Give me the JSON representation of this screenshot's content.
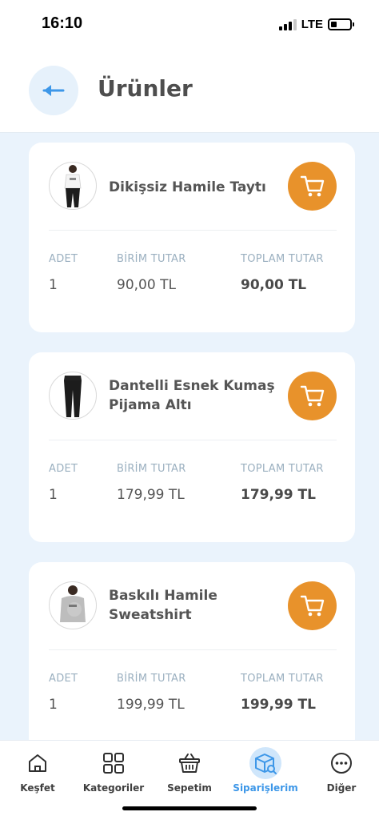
{
  "status_bar": {
    "time": "16:10",
    "network": "LTE"
  },
  "header": {
    "title": "Ürünler",
    "back_icon": "arrow-left-icon"
  },
  "columns": {
    "qty": "ADET",
    "unit": "BİRİM TUTAR",
    "total": "TOPLAM TUTAR"
  },
  "products": [
    {
      "name": "Dikişsiz Hamile Taytı",
      "qty": "1",
      "unit_price": "90,00 TL",
      "total_price": "90,00 TL"
    },
    {
      "name": "Dantelli Esnek Kumaş Pijama Altı",
      "qty": "1",
      "unit_price": "179,99 TL",
      "total_price": "179,99 TL"
    },
    {
      "name": "Baskılı Hamile Sweatshirt",
      "qty": "1",
      "unit_price": "199,99 TL",
      "total_price": "199,99 TL"
    }
  ],
  "nav": {
    "items": [
      {
        "label": "Keşfet",
        "icon": "home-icon"
      },
      {
        "label": "Kategoriler",
        "icon": "grid-icon"
      },
      {
        "label": "Sepetim",
        "icon": "basket-icon"
      },
      {
        "label": "Siparişlerim",
        "icon": "box-search-icon"
      },
      {
        "label": "Diğer",
        "icon": "more-icon"
      }
    ],
    "active": "Siparişlerim"
  },
  "colors": {
    "accent_orange": "#e8922b",
    "accent_blue": "#3d97e8",
    "background": "#eaf3fc"
  }
}
